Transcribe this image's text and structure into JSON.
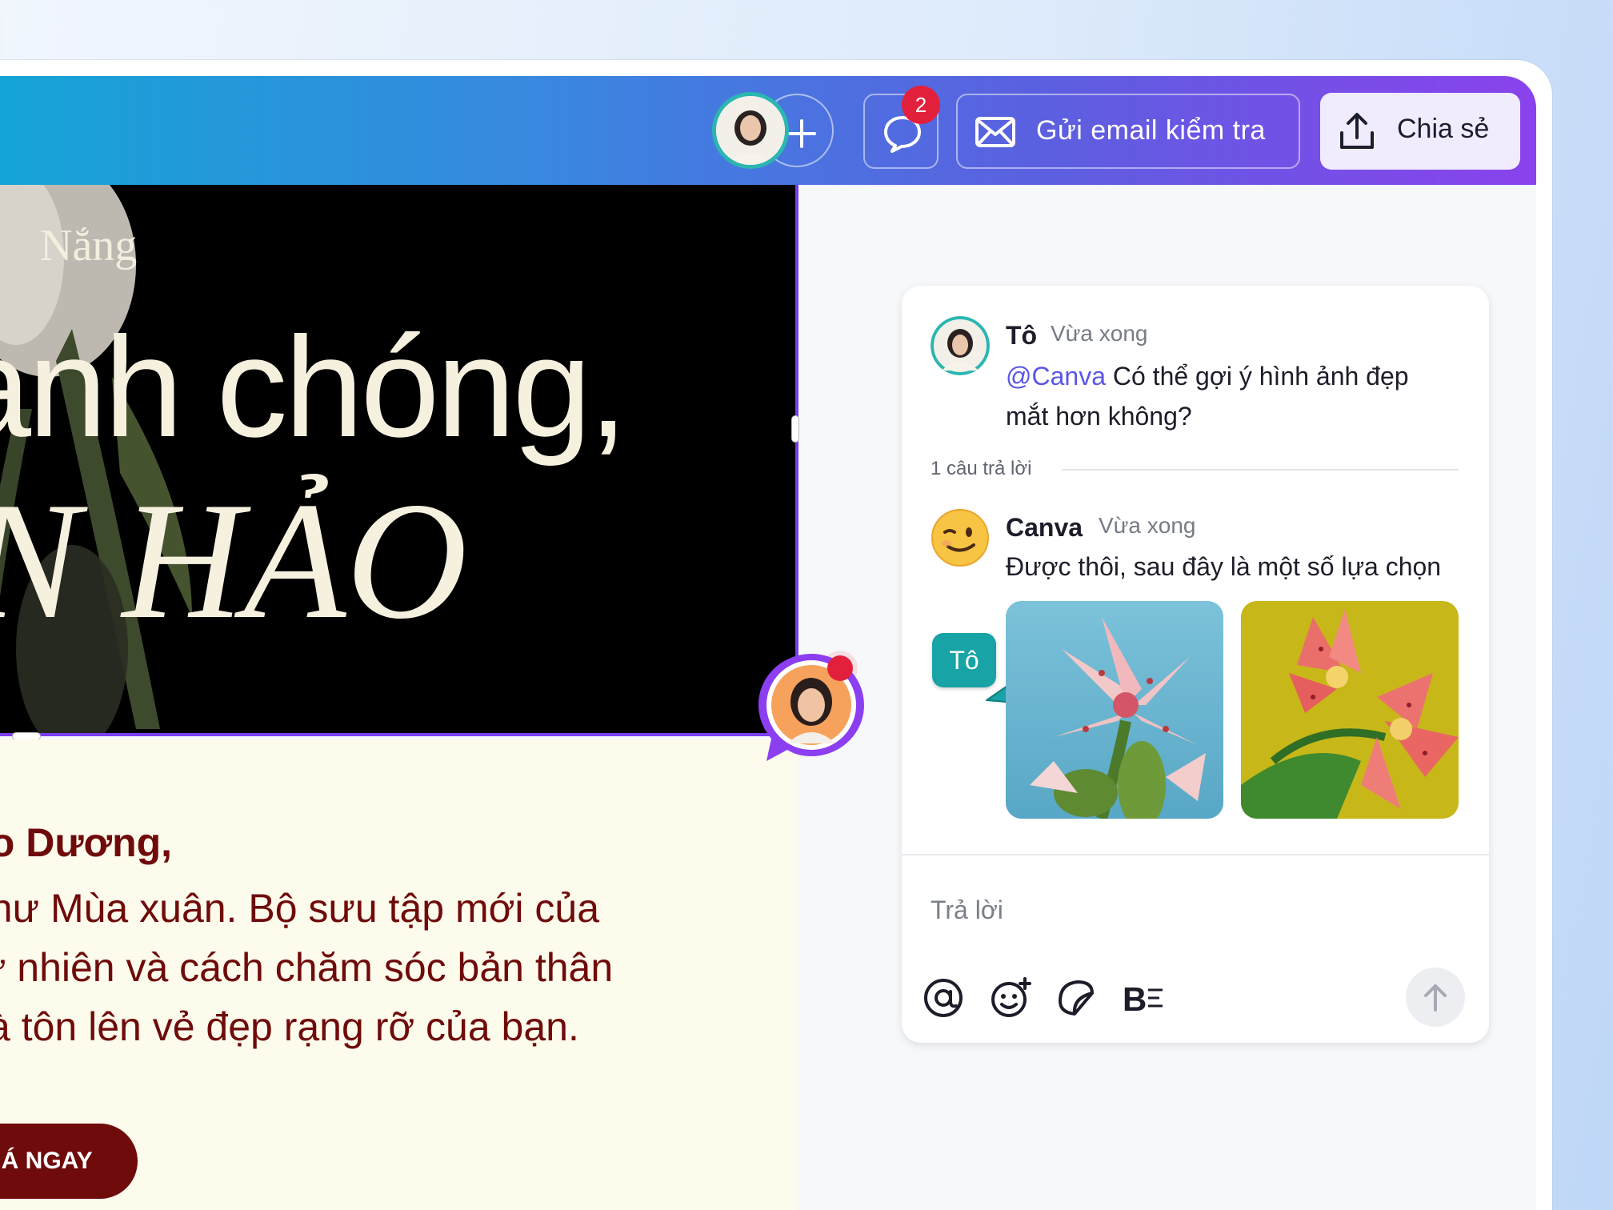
{
  "topbar": {
    "comment_badge_count": "2",
    "email_button_label": "Gửi email kiểm tra",
    "share_button_label": "Chia sẻ",
    "icons": [
      "user-avatar",
      "plus-icon",
      "comment-icon",
      "mail-icon",
      "upload-icon"
    ]
  },
  "design": {
    "brand_text": "Nắng",
    "headline_line1": "anh chóng,",
    "headline_line2": "N HẢO",
    "greeting": "ảo Dương,",
    "body_lines": [
      "như Mùa xuân. Bộ sưu tập mới của",
      "tự nhiên và cách chăm sóc bản thân",
      "và tôn lên vẻ đẹp rạng rỡ của bạn."
    ],
    "cta_label": "HÁ NGAY"
  },
  "comments": {
    "thread": {
      "author": "Tô",
      "time": "Vừa xong",
      "mention": "@Canva",
      "text_part1": " Có thể gợi ý hình ảnh đẹp",
      "text_part2": "mắt hơn không?"
    },
    "replies_label": "1 câu trả lời",
    "reply": {
      "author": "Canva",
      "time": "Vừa xong",
      "text": "Được thôi, sau đây là một số lựa chọn"
    },
    "cursor_tag": "Tô",
    "reply_placeholder": "Trả lời",
    "tool_icons": [
      "mention-icon",
      "emoji-icon",
      "sticker-icon",
      "text-format-icon",
      "send-icon"
    ]
  },
  "colors": {
    "accent_purple": "#7a3ff0",
    "teal_tag": "#18a3a6",
    "badge_red": "#e3203b",
    "maroon": "#6f0b0b"
  }
}
